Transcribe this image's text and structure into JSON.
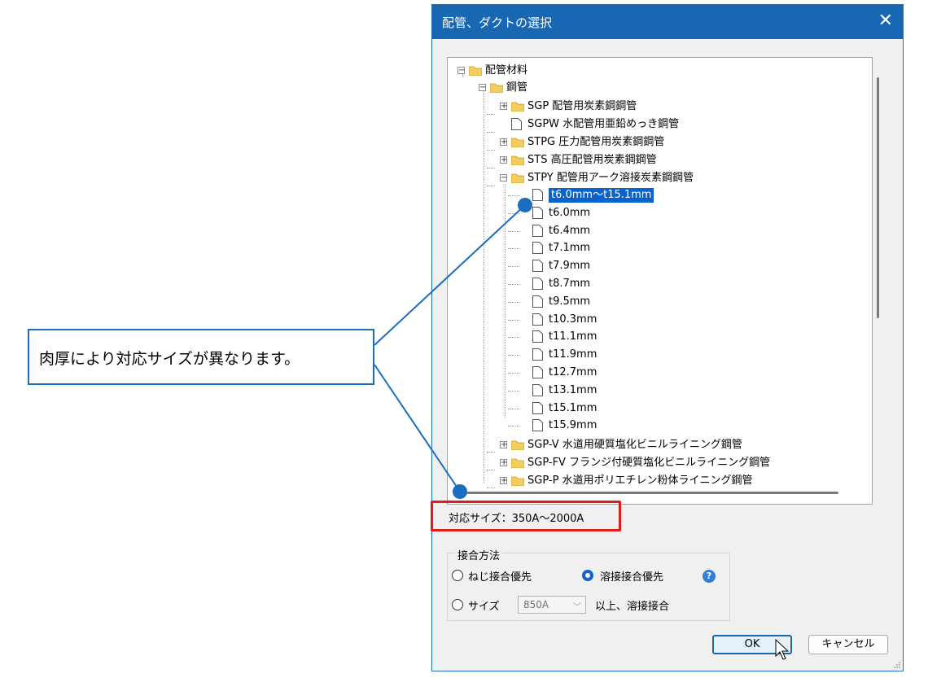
{
  "dialog": {
    "title": "配管、ダクトの選択",
    "close_glyph": "✕"
  },
  "tree": {
    "root": "配管材料",
    "steel": "鋼管",
    "items": [
      {
        "label": "SGP 配管用炭素鋼鋼管",
        "type": "folder",
        "expanded": false
      },
      {
        "label": "SGPW 水配管用亜鉛めっき鋼管",
        "type": "file"
      },
      {
        "label": "STPG 圧力配管用炭素鋼鋼管",
        "type": "folder",
        "expanded": false
      },
      {
        "label": "STS 高圧配管用炭素鋼鋼管",
        "type": "folder",
        "expanded": false
      },
      {
        "label": "STPY 配管用アーク溶接炭素鋼鋼管",
        "type": "folder",
        "expanded": true
      }
    ],
    "stpy_children": [
      "t6.0mm～t15.1mm",
      "t6.0mm",
      "t6.4mm",
      "t7.1mm",
      "t7.9mm",
      "t8.7mm",
      "t9.5mm",
      "t10.3mm",
      "t11.1mm",
      "t11.9mm",
      "t12.7mm",
      "t13.1mm",
      "t15.1mm",
      "t15.9mm"
    ],
    "selected_index": 0,
    "after_items": [
      "SGP-V 水道用硬質塩化ビニルライニング鋼管",
      "SGP-FV フランジ付硬質塩化ビニルライニング鋼管",
      "SGP-P 水道用ポリエチレン粉体ライニング鋼管"
    ]
  },
  "size_info": "対応サイズ：350A～2000A",
  "join": {
    "group_title": "接合方法",
    "opt_thread": "ねじ接合優先",
    "opt_weld": "溶接接合優先",
    "opt_size": "サイズ",
    "size_value": "850A",
    "size_suffix": "以上、溶接接合",
    "selected": "weld"
  },
  "buttons": {
    "ok": "OK",
    "cancel": "キャンセル"
  },
  "annotation": {
    "text": "肉厚により対応サイズが異なります。"
  },
  "colors": {
    "titlebar": "#1767b3",
    "selection": "#0a62cc",
    "highlight": "#e11a1a",
    "callout": "#1a6ebd"
  }
}
